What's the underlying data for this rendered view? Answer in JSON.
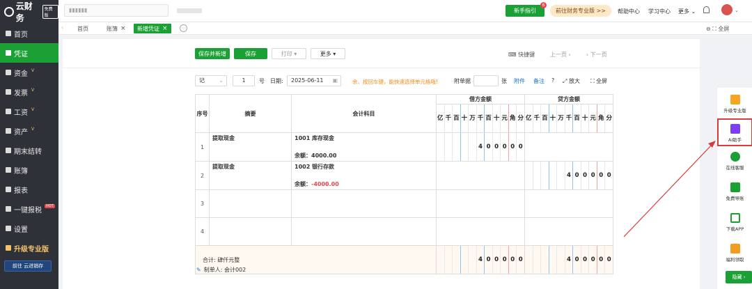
{
  "sidebar": {
    "logo_text": "云财务",
    "logo_tag": "免费版",
    "items": [
      {
        "label": "首页",
        "vip": ""
      },
      {
        "label": "凭证",
        "vip": ""
      },
      {
        "label": "资金",
        "vip": "V"
      },
      {
        "label": "发票",
        "vip": "V"
      },
      {
        "label": "工资",
        "vip": "V"
      },
      {
        "label": "资产",
        "vip": "V"
      },
      {
        "label": "期末结转",
        "vip": ""
      },
      {
        "label": "账簿",
        "vip": ""
      },
      {
        "label": "报表",
        "vip": ""
      },
      {
        "label": "一键报税",
        "vip": "HOT"
      },
      {
        "label": "设置",
        "vip": ""
      },
      {
        "label": "升级专业版",
        "vip": ""
      }
    ],
    "bottom_button": "前往 云进销存"
  },
  "topbar": {
    "newbie_label": "新手指引",
    "newbie_badge": "6",
    "pro_label": "前往财务专业版 >>",
    "help_label": "帮助中心",
    "study_label": "学习中心",
    "more_label": "更多"
  },
  "tabs": {
    "items": [
      "首页",
      "账簿",
      "新增凭证"
    ],
    "fullscreen_label": "全屏"
  },
  "toolbar": {
    "save_new_label": "保存并新增",
    "save_label": "保存",
    "print_label": "打印",
    "more_label": "更多",
    "shortcut_label": "快捷键",
    "prev_label": "上一页",
    "next_label": "下一页"
  },
  "meta": {
    "word": "记",
    "number": "1",
    "number_unit": "号",
    "date_label": "日期:",
    "date_value": "2025-06-11",
    "hint": "余、按回车键，能快速选择单元格哦!",
    "attach_count_label": "附单据",
    "attach_unit": "张",
    "attachment_label": "附件",
    "remark_label": "备注",
    "zoom_label": "放大",
    "fullscreen_label": "全屏"
  },
  "voucher": {
    "headers": {
      "index": "序号",
      "summary": "摘要",
      "subject": "会计科目",
      "debit": "借方金额",
      "credit": "贷方金额"
    },
    "digit_units": [
      "亿",
      "千",
      "百",
      "十",
      "万",
      "千",
      "百",
      "十",
      "元",
      "角",
      "分"
    ],
    "rows": [
      {
        "index": "1",
        "summary": "提取现金",
        "subject": "1001 库存现金",
        "balance_label": "余额：",
        "balance": "4000.00",
        "debit": "400000",
        "credit": ""
      },
      {
        "index": "2",
        "summary": "提取现金",
        "subject": "1002 银行存款",
        "balance_label": "余额：",
        "balance": "-4000.00",
        "debit": "",
        "credit": "400000"
      },
      {
        "index": "3",
        "summary": "",
        "subject": "",
        "balance_label": "",
        "balance": "",
        "debit": "",
        "credit": ""
      },
      {
        "index": "4",
        "summary": "",
        "subject": "",
        "balance_label": "",
        "balance": "",
        "debit": "",
        "credit": ""
      }
    ],
    "total_label": "合计: 肆仟元整",
    "total_debit": "400000",
    "total_credit": "400000",
    "maker_label": "制单人: 会计002"
  },
  "float_panel": {
    "items": [
      "升级专业版",
      "AI助手",
      "在线客服",
      "免费导账",
      "下载APP",
      "福利领取"
    ],
    "reward_label": "隐藏"
  },
  "colors": {
    "accent": "#1aa034",
    "sidebar_bg": "#2e3238",
    "highlight_red": "#d93a3a"
  }
}
